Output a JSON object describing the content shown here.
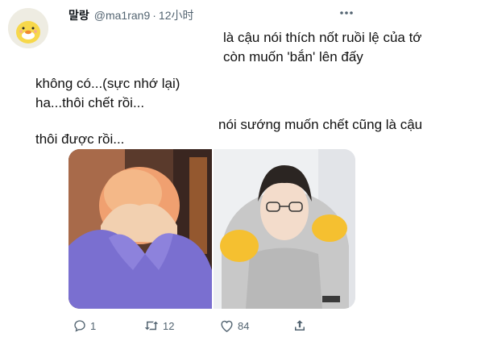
{
  "tweet": {
    "display_name": "말랑",
    "handle": "@ma1ran9",
    "separator": "·",
    "time": "12小时",
    "more_icon": "more-icon",
    "lines": [
      "là cậu nói thích nốt ruồi lệ của tớ",
      "còn muốn 'bắn' lên đấy",
      "không có...(sực nhớ lại)",
      "ha...thôi chết rồi...",
      "nói sướng muốn chết cũng là cậu",
      "thôi được rồi..."
    ]
  },
  "actions": {
    "reply_count": "1",
    "retweet_count": "12",
    "like_count": "84",
    "icons": [
      "reply-icon",
      "retweet-icon",
      "like-icon",
      "share-icon"
    ]
  },
  "colors": {
    "secondary_text": "#536471",
    "primary_text": "#0f1419",
    "left_photo_sleeve": "#7a6fd0",
    "left_photo_hair": "#f0a070",
    "right_photo_pillow": "#f5c030",
    "right_photo_hoodie": "#bfbfbf"
  }
}
